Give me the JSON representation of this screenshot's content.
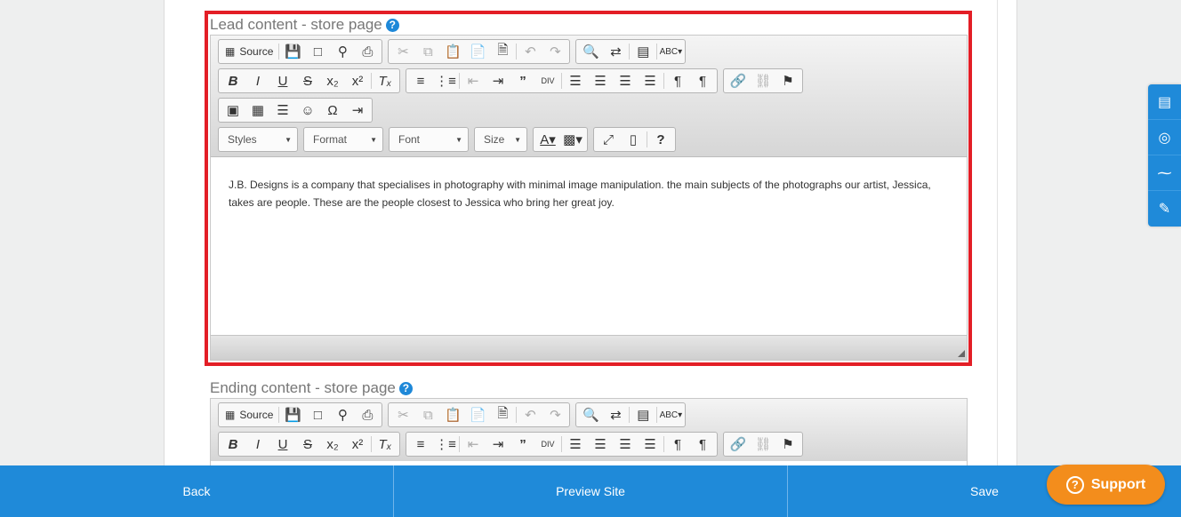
{
  "lead_editor": {
    "label": "Lead content - store page",
    "help_glyph": "?",
    "content": "J.B. Designs is a company that specialises in photography with minimal image manipulation. the main subjects of the photographs our artist, Jessica, takes are people. These are the people closest to Jessica who bring her great joy."
  },
  "ending_editor": {
    "label": "Ending content - store page",
    "help_glyph": "?"
  },
  "toolbar": {
    "source_label": "Source",
    "styles_label": "Styles",
    "format_label": "Format",
    "font_label": "Font",
    "size_label": "Size",
    "help_glyph": "?"
  },
  "footer": {
    "back_label": "Back",
    "preview_label": "Preview Site",
    "save_label": "Save"
  },
  "support": {
    "label": "Support",
    "glyph": "?"
  },
  "colors": {
    "accent": "#1f8ad9",
    "highlight": "#e31e26",
    "support": "#f38d1c"
  }
}
